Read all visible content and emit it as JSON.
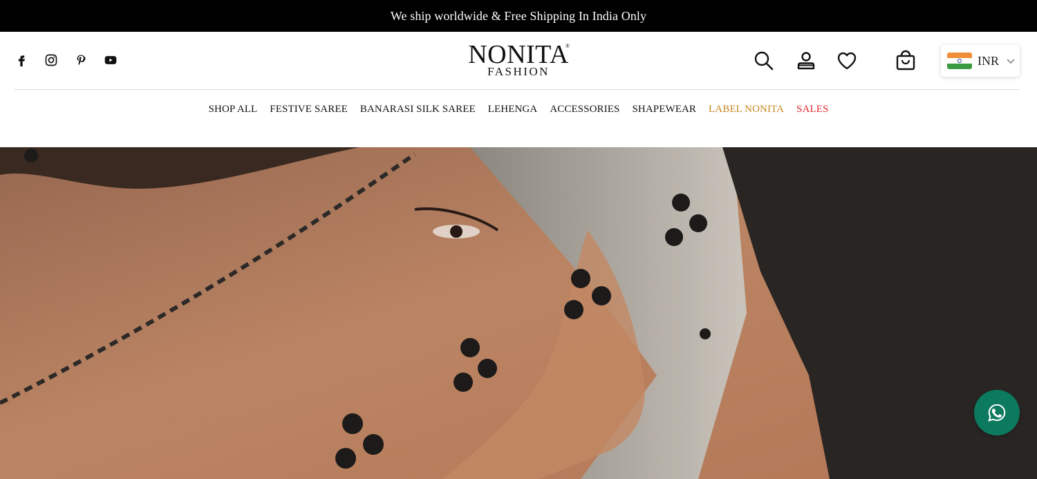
{
  "announcement": "We ship worldwide & Free Shipping In India Only",
  "social": [
    "facebook-icon",
    "instagram-icon",
    "pinterest-icon",
    "youtube-icon"
  ],
  "logo": {
    "brand": "NONITA",
    "sub": "FASHION",
    "mark": "®"
  },
  "header_icons": [
    "search-icon",
    "account-icon",
    "wishlist-icon",
    "cart-icon"
  ],
  "currency": {
    "code": "INR",
    "flag": "india-flag"
  },
  "nav": [
    {
      "label": "SHOP ALL",
      "color": "#111111"
    },
    {
      "label": "FESTIVE SAREE",
      "color": "#111111"
    },
    {
      "label": "BANARASI SILK SAREE",
      "color": "#111111"
    },
    {
      "label": "LEHENGA",
      "color": "#111111"
    },
    {
      "label": "ACCESSORIES",
      "color": "#111111"
    },
    {
      "label": "SHAPEWEAR",
      "color": "#111111"
    },
    {
      "label": "LABEL NONITA",
      "color": "#c8861e"
    },
    {
      "label": "SALES",
      "color": "#e0262b"
    }
  ],
  "colors": {
    "topbar": "#000000",
    "whatsapp": "#0c7a5e"
  },
  "chat": {
    "icon": "whatsapp-icon"
  }
}
